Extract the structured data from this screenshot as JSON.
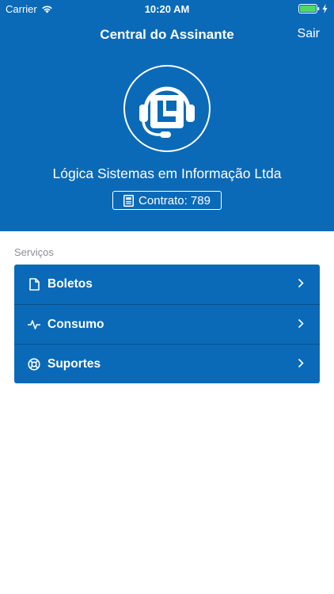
{
  "status_bar": {
    "carrier": "Carrier",
    "time": "10:20 AM"
  },
  "nav": {
    "title": "Central do Assinante",
    "logout_label": "Sair"
  },
  "profile": {
    "company": "Lógica Sistemas em Informação Ltda",
    "contract": "Contrato: 789"
  },
  "services": {
    "section_label": "Serviços",
    "items": [
      {
        "label": "Boletos",
        "icon": "document-icon"
      },
      {
        "label": "Consumo",
        "icon": "activity-icon"
      },
      {
        "label": "Suportes",
        "icon": "lifebuoy-icon"
      }
    ]
  },
  "colors": {
    "primary": "#0a6ab8",
    "divider": "#0b4f86",
    "battery": "#4cd964"
  }
}
